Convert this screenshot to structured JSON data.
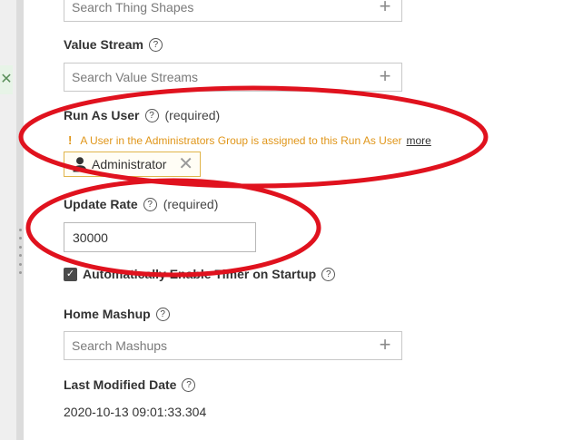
{
  "sidebar": {
    "close_glyph": "✕"
  },
  "form": {
    "thing_shapes": {
      "placeholder": "Search Thing Shapes"
    },
    "value_stream": {
      "label": "Value Stream",
      "placeholder": "Search Value Streams"
    },
    "run_as_user": {
      "label": "Run As User",
      "required_text": "(required)",
      "warning_mark": "!",
      "warning_text": "A User in the Administrators Group is assigned to this Run As User",
      "more_link": "more",
      "selected_user": "Administrator"
    },
    "update_rate": {
      "label": "Update Rate",
      "required_text": "(required)",
      "value": "30000"
    },
    "auto_enable_timer": {
      "label": "Automatically Enable Timer on Startup",
      "checked": true
    },
    "home_mashup": {
      "label": "Home Mashup",
      "placeholder": "Search Mashups"
    },
    "last_modified_date": {
      "label": "Last Modified Date",
      "value": "2020-10-13 09:01:33.304"
    }
  },
  "icons": {
    "help": "?",
    "plus": "+",
    "remove": "✕",
    "check": "✓"
  },
  "colors": {
    "warning": "#e0961a",
    "annotation": "#e0121e",
    "chip_border": "#e0b44a"
  }
}
